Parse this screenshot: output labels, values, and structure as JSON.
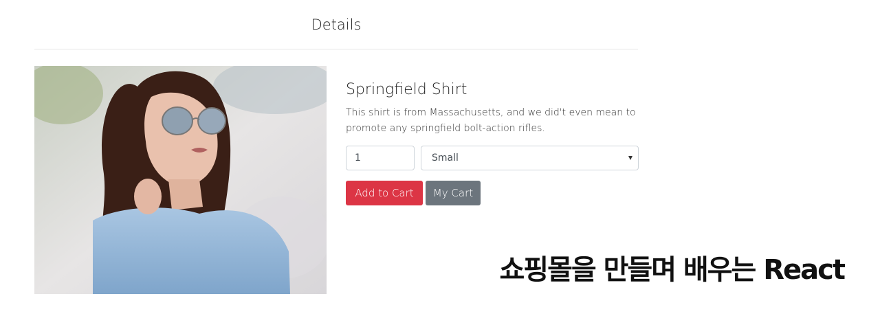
{
  "header": {
    "title": "Details"
  },
  "product": {
    "image_alt": "Woman wearing aviator sunglasses and a light blue shirt",
    "title": "Springfield Shirt",
    "description": "This shirt is from Massachusetts, and we did't even mean to promote any springfield bolt-action rifles.",
    "quantity": "1",
    "size": {
      "selected": "Small"
    }
  },
  "buttons": {
    "add_to_cart": "Add to Cart",
    "my_cart": "My Cart"
  },
  "colors": {
    "danger": "#dc3545",
    "secondary": "#6c757d"
  },
  "banner": {
    "text": "쇼핑몰을 만들며 배우는 React"
  }
}
